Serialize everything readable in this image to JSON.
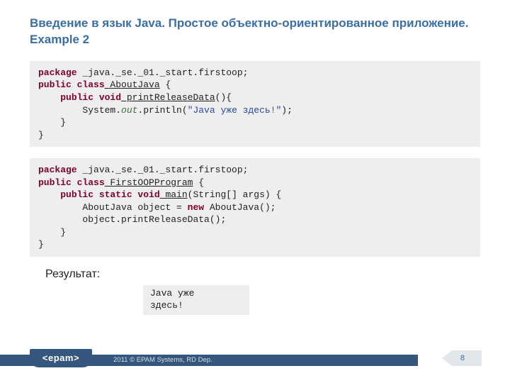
{
  "title": "Введение в язык Java. Простое объектно-ориентированное приложение. Example 2",
  "code1": {
    "pkg_kw": "package",
    "pkg_name": " _java._se._01._start.firstoop;",
    "pub_class": "public class",
    "class_name": " AboutJava",
    "brace_open": " {",
    "m_sig_kw": "public void",
    "m_name": " printReleaseData",
    "m_paren": "(){",
    "sysout_pre": "System.",
    "sysout_out": "out",
    "sysout_post": ".println(",
    "string": "\"Java уже здесь!\"",
    "after_str": ");",
    "close1": "    }",
    "close2": "}"
  },
  "code2": {
    "pkg_kw": "package",
    "pkg_name": " _java._se._01._start.firstoop;",
    "pub_class": "public class",
    "class_name": " FirstOOPProgram",
    "brace_open": " {",
    "m_kw": "public static void",
    "m_name": " main",
    "m_args": "(String[] args) {",
    "line_new_pre": "AboutJava object = ",
    "new_kw": "new",
    "line_new_post": " AboutJava();",
    "line_call": "object.printReleaseData();",
    "close1": "    }",
    "close2": "}"
  },
  "result_label": "Результат:",
  "output": "Java уже\nздесь!",
  "footer": {
    "logo": "<epam>",
    "text": "2011 © EPAM Systems, RD Dep."
  },
  "page_number": "8"
}
